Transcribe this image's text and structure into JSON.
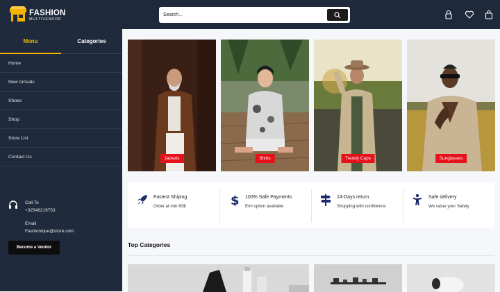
{
  "header": {
    "brand_name": "FASHION",
    "brand_sub": "MULTIVENDOR",
    "search_placeholder": "Search...",
    "icons": [
      "lock-icon",
      "heart-icon",
      "bag-icon"
    ]
  },
  "sidebar": {
    "tabs": [
      {
        "label": "Menu",
        "active": true
      },
      {
        "label": "Categories",
        "active": false
      }
    ],
    "menu_items": [
      {
        "label": "Home"
      },
      {
        "label": "New Arrivals"
      },
      {
        "label": "Shoes"
      },
      {
        "label": "Shop"
      },
      {
        "label": "Store List"
      },
      {
        "label": "Contact Us"
      }
    ],
    "call_label": "Call To",
    "phone": "+32546219753",
    "email_label": "Email",
    "email": "Fashionique@store.com",
    "vendor_button": "Become a Vendor"
  },
  "cards": [
    {
      "label": "Jackets",
      "icon": "photo-jacket-man"
    },
    {
      "label": "Shirts",
      "icon": "photo-shirt-man"
    },
    {
      "label": "Trendy Caps",
      "icon": "photo-cap-man"
    },
    {
      "label": "Sunglasses",
      "icon": "photo-sunglasses-man"
    }
  ],
  "features": [
    {
      "title": "Fastest Shiping",
      "sub": "Order at min 60$",
      "icon": "rocket-icon"
    },
    {
      "title": "100% Safe Payments",
      "sub": "Emi option available",
      "icon": "dollar-icon"
    },
    {
      "title": "14-Days return",
      "sub": "Shopping with confidence",
      "icon": "signpost-icon"
    },
    {
      "title": "Safe delivery",
      "sub": "We value your Safety",
      "icon": "person-icon"
    }
  ],
  "top_categories_title": "Top Categories",
  "colors": {
    "navy": "#1e2a3c",
    "accent": "#f4b400",
    "label_red": "#e8101a",
    "icon_navy": "#1b2a6b"
  }
}
